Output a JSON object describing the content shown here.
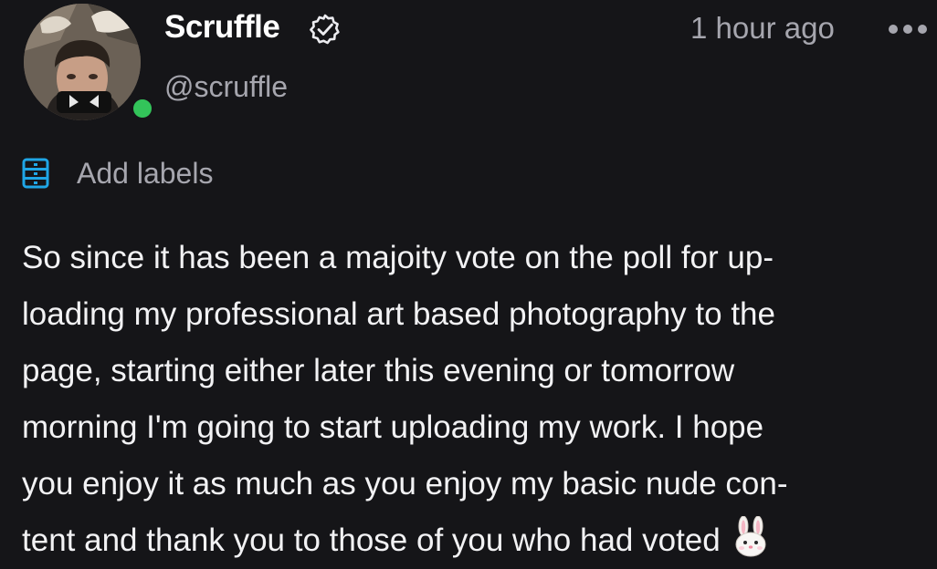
{
  "post": {
    "author": {
      "display_name": "Scruffle",
      "handle": "@scruffle",
      "verified": true,
      "online": true,
      "status_color": "#33c45a"
    },
    "timestamp": "1 hour ago",
    "more_icon": "more-horizontal-icon",
    "labels": {
      "icon": "labels-icon",
      "label": "Add labels",
      "icon_color": "#1fa6e6"
    },
    "body_lines": [
      "So since it has been a majoity vote on the poll for up-",
      "loading my professional art based photography to the",
      "page, starting either later this evening or tomorrow",
      "morning I'm going to start uploading my work. I hope",
      "you enjoy it as much as you enjoy my basic nude con-",
      "tent and thank you to those of you who had voted"
    ],
    "body_emoji": "rabbit-face-emoji"
  },
  "colors": {
    "background": "#151518",
    "primary_text": "#f2f2f4",
    "secondary_text": "#a6a6ae"
  }
}
